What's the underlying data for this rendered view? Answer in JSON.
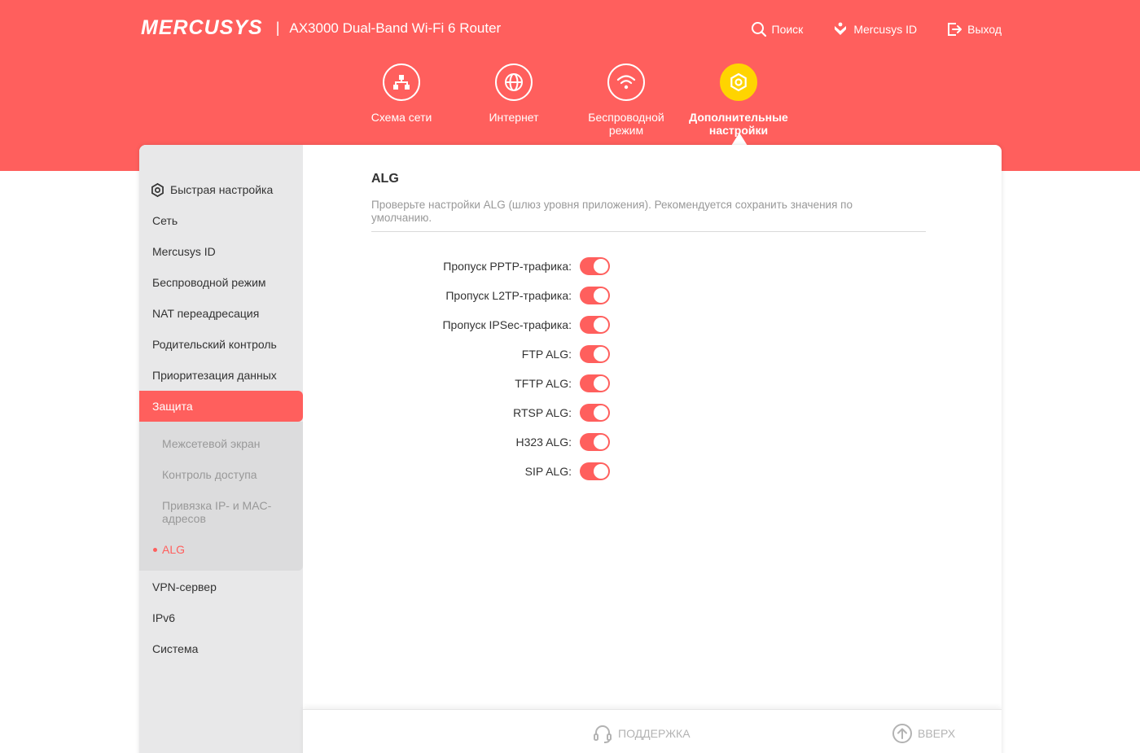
{
  "header": {
    "logo": "MERCUSYS",
    "separator": "|",
    "model": "AX3000 Dual-Band Wi-Fi 6 Router",
    "links": [
      {
        "label": "Поиск",
        "icon": "search-icon"
      },
      {
        "label": "Mercusys ID",
        "icon": "mercusys-id-icon"
      },
      {
        "label": "Выход",
        "icon": "logout-icon"
      }
    ]
  },
  "nav": {
    "items": [
      {
        "label": "Схема сети",
        "icon": "network-map-icon",
        "active": false
      },
      {
        "label": "Интернет",
        "icon": "globe-icon",
        "active": false
      },
      {
        "label": "Беспроводной режим",
        "icon": "wifi-icon",
        "active": false
      },
      {
        "label": "Дополнительные настройки",
        "icon": "gear-icon",
        "active": true
      }
    ]
  },
  "sidebar": {
    "items": [
      {
        "label": "Быстрая настройка",
        "icon": "gear-icon"
      },
      {
        "label": "Сеть"
      },
      {
        "label": "Mercusys ID"
      },
      {
        "label": "Беспроводной режим"
      },
      {
        "label": "NAT переадресация"
      },
      {
        "label": "Родительский контроль"
      },
      {
        "label": "Приоритезация данных"
      },
      {
        "label": "Защита",
        "active": true
      },
      {
        "label": "VPN-сервер"
      },
      {
        "label": "IPv6"
      },
      {
        "label": "Система"
      }
    ],
    "subitems": [
      {
        "label": "Межсетевой экран"
      },
      {
        "label": "Контроль доступа"
      },
      {
        "label": "Привязка IP- и MAC-адресов"
      },
      {
        "label": "ALG",
        "active": true
      }
    ]
  },
  "alg": {
    "title": "ALG",
    "description": "Проверьте настройки ALG (шлюз уровня приложения). Рекомендуется сохранить значения по умолчанию.",
    "rows": [
      {
        "label": "Пропуск PPTP-трафика:",
        "enabled": true
      },
      {
        "label": "Пропуск L2TP-трафика:",
        "enabled": true
      },
      {
        "label": "Пропуск IPSec-трафика:",
        "enabled": true
      },
      {
        "label": "FTP ALG:",
        "enabled": true
      },
      {
        "label": "TFTP ALG:",
        "enabled": true
      },
      {
        "label": "RTSP ALG:",
        "enabled": true
      },
      {
        "label": "H323 ALG:",
        "enabled": true
      },
      {
        "label": "SIP ALG:",
        "enabled": true
      }
    ]
  },
  "footer": {
    "support_label": "ПОДДЕРЖКА",
    "top_label": "ВВЕРХ"
  },
  "colors": {
    "brand": "#ff5f5d",
    "active_nav": "#ffd400",
    "sidebar_bg": "#e8e8e9"
  }
}
